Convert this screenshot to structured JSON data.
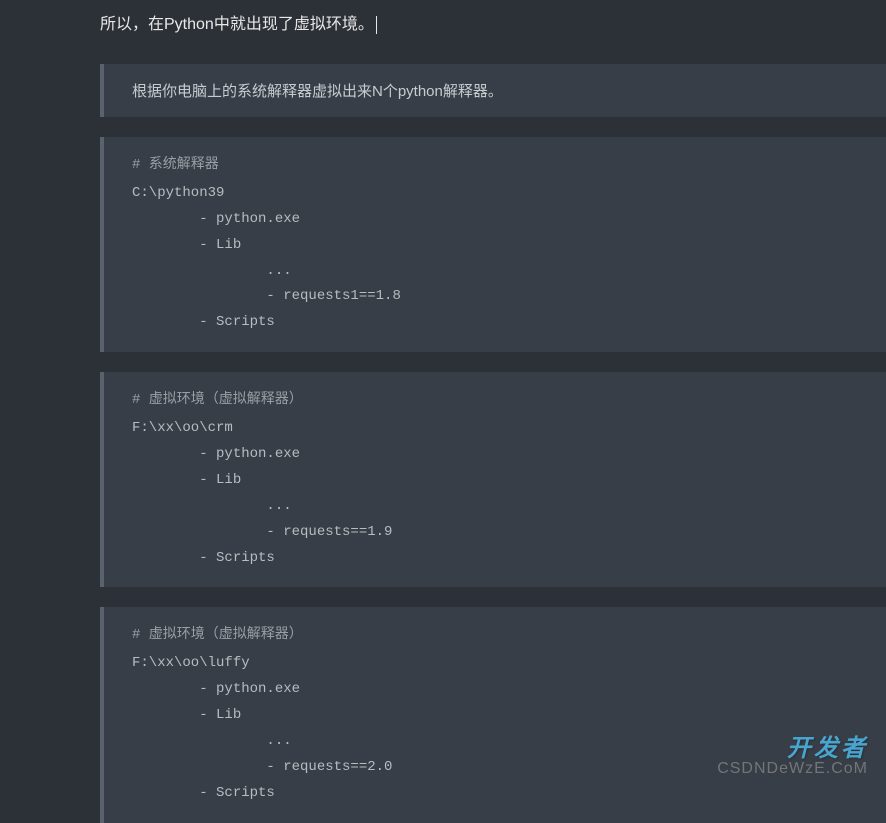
{
  "intro": "所以，在Python中就出现了虚拟环境。",
  "quote": "根据你电脑上的系统解释器虚拟出来N个python解释器。",
  "codeBlocks": [
    {
      "comment": "# 系统解释器",
      "path": "C:\\python39",
      "items": [
        "        - python.exe",
        "        - Lib",
        "                ...",
        "                - requests1==1.8",
        "        - Scripts"
      ]
    },
    {
      "comment": "# 虚拟环境（虚拟解释器）",
      "path": "F:\\xx\\oo\\crm",
      "items": [
        "        - python.exe",
        "        - Lib",
        "                ...",
        "                - requests==1.9",
        "        - Scripts"
      ]
    },
    {
      "comment": "# 虚拟环境（虚拟解释器）",
      "path": "F:\\xx\\oo\\luffy",
      "items": [
        "        - python.exe",
        "        - Lib",
        "                ...",
        "                - requests==2.0",
        "        - Scripts"
      ]
    }
  ],
  "watermark": {
    "top": "开发者",
    "bottom": "CSDNDeWzE.CoM"
  }
}
